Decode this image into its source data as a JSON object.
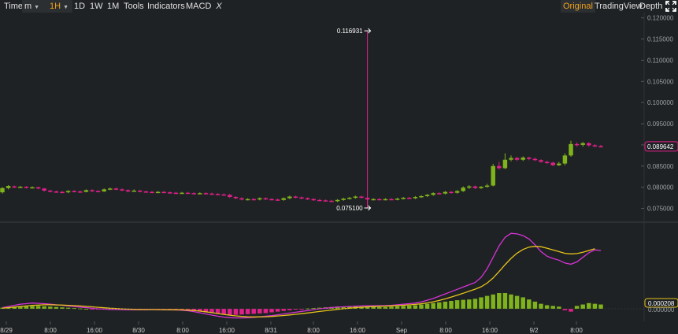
{
  "toolbar": {
    "time_label": "Time",
    "interval_select": "m",
    "active_interval": "1H",
    "intervals": [
      "1D",
      "1W",
      "1M"
    ],
    "tools_label": "Tools",
    "indicators_label": "Indicators",
    "indicator_name": "MACD",
    "indicator_remove": "X",
    "modes": [
      "Original",
      "TradingView",
      "Depth"
    ],
    "active_mode": "Original"
  },
  "colors": {
    "up": "#7fb31c",
    "down": "#e0208a",
    "macd_line": "#d633d6",
    "signal_line": "#e6c21a",
    "marker_line": "#e0208a",
    "background": "#1f2224"
  },
  "chart_data": {
    "type": "candlestick",
    "title": "",
    "price_axis": {
      "ticks": [
        "0.120000",
        "0.115000",
        "0.110000",
        "0.105000",
        "0.100000",
        "0.095000",
        "0.090000",
        "0.085000",
        "0.080000",
        "0.075000"
      ],
      "range": [
        0.0725,
        0.1205
      ]
    },
    "x_labels": [
      "8/29",
      "8:00",
      "16:00",
      "8/30",
      "8:00",
      "16:00",
      "8/31",
      "8:00",
      "16:00",
      "Sep",
      "8:00",
      "16:00",
      "9/2",
      "8:00"
    ],
    "current_price": "0.089642",
    "annotations": {
      "high": "0.116931",
      "low": "0.075100"
    },
    "candles": [
      [
        0.0788,
        0.0798,
        0.0785,
        0.08
      ],
      [
        0.0798,
        0.0803,
        0.0795,
        0.0805
      ],
      [
        0.0802,
        0.08,
        0.0798,
        0.0804
      ],
      [
        0.08,
        0.0801,
        0.0798,
        0.0803
      ],
      [
        0.0801,
        0.0799,
        0.0797,
        0.0803
      ],
      [
        0.0799,
        0.08,
        0.0797,
        0.0802
      ],
      [
        0.08,
        0.0797,
        0.0795,
        0.0801
      ],
      [
        0.0797,
        0.0792,
        0.079,
        0.0798
      ],
      [
        0.0792,
        0.079,
        0.0788,
        0.0794
      ],
      [
        0.079,
        0.0789,
        0.0787,
        0.0792
      ],
      [
        0.0789,
        0.0788,
        0.0786,
        0.0791
      ],
      [
        0.0788,
        0.0791,
        0.0786,
        0.0793
      ],
      [
        0.0791,
        0.079,
        0.0788,
        0.0793
      ],
      [
        0.079,
        0.0789,
        0.0787,
        0.0792
      ],
      [
        0.0789,
        0.0793,
        0.0788,
        0.0795
      ],
      [
        0.0793,
        0.0791,
        0.0789,
        0.0795
      ],
      [
        0.0791,
        0.079,
        0.0788,
        0.0793
      ],
      [
        0.079,
        0.0795,
        0.0789,
        0.0797
      ],
      [
        0.0795,
        0.0797,
        0.0793,
        0.0799
      ],
      [
        0.0797,
        0.0795,
        0.0793,
        0.0799
      ],
      [
        0.0795,
        0.0793,
        0.0791,
        0.0797
      ],
      [
        0.0793,
        0.079,
        0.0788,
        0.0795
      ],
      [
        0.079,
        0.0792,
        0.0789,
        0.0795
      ],
      [
        0.0792,
        0.079,
        0.0788,
        0.0794
      ],
      [
        0.079,
        0.0789,
        0.0787,
        0.0792
      ],
      [
        0.0789,
        0.0788,
        0.0786,
        0.0791
      ],
      [
        0.0788,
        0.0789,
        0.0786,
        0.0791
      ],
      [
        0.0789,
        0.0788,
        0.0786,
        0.0791
      ],
      [
        0.0788,
        0.0787,
        0.0785,
        0.079
      ],
      [
        0.0787,
        0.0786,
        0.0784,
        0.0789
      ],
      [
        0.0786,
        0.0787,
        0.0784,
        0.0789
      ],
      [
        0.0787,
        0.0786,
        0.0784,
        0.0789
      ],
      [
        0.0786,
        0.0785,
        0.0783,
        0.0788
      ],
      [
        0.0785,
        0.0786,
        0.0783,
        0.0788
      ],
      [
        0.0786,
        0.0785,
        0.0783,
        0.0788
      ],
      [
        0.0785,
        0.0784,
        0.0782,
        0.0787
      ],
      [
        0.0784,
        0.0783,
        0.0781,
        0.0786
      ],
      [
        0.0783,
        0.0782,
        0.078,
        0.0785
      ],
      [
        0.0782,
        0.0777,
        0.0775,
        0.0784
      ],
      [
        0.0777,
        0.0774,
        0.0772,
        0.0779
      ],
      [
        0.0774,
        0.0771,
        0.0769,
        0.0776
      ],
      [
        0.0771,
        0.0772,
        0.0769,
        0.0774
      ],
      [
        0.0772,
        0.0771,
        0.0769,
        0.0774
      ],
      [
        0.0771,
        0.0774,
        0.0769,
        0.0776
      ],
      [
        0.0774,
        0.0772,
        0.077,
        0.0776
      ],
      [
        0.0772,
        0.0771,
        0.0769,
        0.0774
      ],
      [
        0.0771,
        0.077,
        0.0768,
        0.0773
      ],
      [
        0.077,
        0.0774,
        0.0768,
        0.0776
      ],
      [
        0.0774,
        0.0778,
        0.0772,
        0.078
      ],
      [
        0.0778,
        0.0776,
        0.0774,
        0.078
      ],
      [
        0.0776,
        0.0774,
        0.0772,
        0.0778
      ],
      [
        0.0774,
        0.0772,
        0.077,
        0.0776
      ],
      [
        0.0772,
        0.077,
        0.0768,
        0.0774
      ],
      [
        0.077,
        0.0769,
        0.0767,
        0.0772
      ],
      [
        0.0769,
        0.0768,
        0.0766,
        0.0771
      ],
      [
        0.0768,
        0.0767,
        0.0765,
        0.077
      ],
      [
        0.0767,
        0.077,
        0.0765,
        0.0772
      ],
      [
        0.077,
        0.0773,
        0.0768,
        0.0775
      ],
      [
        0.0773,
        0.0775,
        0.0771,
        0.0777
      ],
      [
        0.0775,
        0.0778,
        0.0773,
        0.078
      ],
      [
        0.0778,
        0.0775,
        0.0774,
        0.078
      ],
      [
        0.0775,
        0.0771,
        0.0751,
        0.0776
      ],
      [
        0.0771,
        0.0772,
        0.0769,
        0.0774
      ],
      [
        0.0772,
        0.0771,
        0.0769,
        0.0774
      ],
      [
        0.0771,
        0.0772,
        0.0769,
        0.0774
      ],
      [
        0.0772,
        0.0771,
        0.0769,
        0.0774
      ],
      [
        0.0771,
        0.0773,
        0.0769,
        0.0775
      ],
      [
        0.0773,
        0.0775,
        0.0771,
        0.0777
      ],
      [
        0.0775,
        0.0774,
        0.0772,
        0.0777
      ],
      [
        0.0774,
        0.0777,
        0.0772,
        0.0779
      ],
      [
        0.0777,
        0.0779,
        0.0775,
        0.0781
      ],
      [
        0.0779,
        0.0782,
        0.0777,
        0.0784
      ],
      [
        0.0782,
        0.0786,
        0.078,
        0.0788
      ],
      [
        0.0786,
        0.0785,
        0.0783,
        0.0788
      ],
      [
        0.0785,
        0.0789,
        0.0783,
        0.0791
      ],
      [
        0.0789,
        0.0787,
        0.0785,
        0.0791
      ],
      [
        0.0787,
        0.0791,
        0.0785,
        0.0793
      ],
      [
        0.0791,
        0.0799,
        0.0789,
        0.0802
      ],
      [
        0.0799,
        0.0802,
        0.0796,
        0.0805
      ],
      [
        0.0802,
        0.0798,
        0.0796,
        0.0804
      ],
      [
        0.0798,
        0.0801,
        0.0796,
        0.0803
      ],
      [
        0.0801,
        0.0804,
        0.0799,
        0.0808
      ],
      [
        0.0804,
        0.085,
        0.0802,
        0.0855
      ],
      [
        0.085,
        0.0845,
        0.0842,
        0.086
      ],
      [
        0.0845,
        0.0865,
        0.0843,
        0.088
      ],
      [
        0.0865,
        0.0869,
        0.0861,
        0.0875
      ],
      [
        0.0869,
        0.0865,
        0.0862,
        0.0872
      ],
      [
        0.0865,
        0.087,
        0.0862,
        0.0873
      ],
      [
        0.087,
        0.0867,
        0.0864,
        0.0872
      ],
      [
        0.0867,
        0.0864,
        0.0862,
        0.087
      ],
      [
        0.0864,
        0.086,
        0.0858,
        0.0866
      ],
      [
        0.086,
        0.0858,
        0.0855,
        0.0862
      ],
      [
        0.0858,
        0.0852,
        0.085,
        0.086
      ],
      [
        0.0852,
        0.0856,
        0.085,
        0.086
      ],
      [
        0.0856,
        0.0875,
        0.0852,
        0.088
      ],
      [
        0.0875,
        0.0902,
        0.0872,
        0.091
      ],
      [
        0.0902,
        0.09,
        0.0896,
        0.0906
      ],
      [
        0.09,
        0.0904,
        0.0896,
        0.0907
      ],
      [
        0.0904,
        0.0899,
        0.0896,
        0.0906
      ],
      [
        0.0899,
        0.0897,
        0.0895,
        0.0902
      ],
      [
        0.0897,
        0.0896,
        0.0894,
        0.09
      ]
    ],
    "macd": {
      "histogram": [
        1.5,
        2,
        2.5,
        3,
        3.5,
        4,
        4,
        3.5,
        3,
        2.5,
        2,
        1.5,
        1,
        0.5,
        0,
        -0.5,
        -1,
        -1.2,
        -1.5,
        -1.5,
        -1.2,
        -1,
        -1,
        -0.8,
        -0.5,
        -0.5,
        -0.3,
        -0.5,
        -0.8,
        -1,
        -1.5,
        -2,
        -3,
        -4,
        -5,
        -6,
        -7,
        -8,
        -8.5,
        -8.5,
        -8,
        -7.5,
        -7,
        -6.5,
        -6,
        -5,
        -4,
        -3,
        -2,
        -1,
        -0.5,
        0.5,
        1,
        1.5,
        2,
        2.5,
        3,
        3,
        3.5,
        3.5,
        3,
        3,
        3,
        2.5,
        2.5,
        3,
        3.5,
        4,
        4.5,
        5,
        6,
        7,
        8,
        9,
        10,
        11,
        12,
        12.5,
        13,
        14,
        16,
        18,
        20,
        22,
        22,
        20,
        18,
        16,
        13,
        10,
        7,
        5,
        4,
        3,
        -2,
        -4,
        4,
        6,
        8,
        7,
        6
      ],
      "macd_line": [
        2,
        4,
        6,
        8,
        9,
        10,
        9.5,
        9,
        8,
        7,
        6,
        5,
        4,
        3,
        2,
        1,
        0,
        -0.5,
        -1,
        -1.3,
        -1.5,
        -1.6,
        -1.7,
        -1.7,
        -1.6,
        -1.5,
        -1.5,
        -1.6,
        -1.8,
        -2,
        -2.5,
        -3.5,
        -5,
        -7,
        -9,
        -11,
        -13,
        -14.5,
        -15.5,
        -16,
        -16,
        -15.5,
        -15,
        -14,
        -13,
        -12,
        -10.5,
        -9,
        -7.5,
        -6,
        -4.5,
        -3,
        -1.5,
        0,
        1,
        2,
        3,
        3.5,
        4,
        4.5,
        5,
        5.2,
        5.4,
        5.5,
        5.6,
        6,
        7,
        8,
        9,
        10,
        12,
        15,
        18,
        22,
        26,
        30,
        34,
        38,
        42,
        46,
        55,
        70,
        90,
        110,
        125,
        132,
        131,
        128,
        122,
        112,
        100,
        92,
        88,
        85,
        80,
        78,
        82,
        90,
        98,
        103,
        102
      ],
      "signal_line": [
        1,
        2,
        3,
        4,
        5,
        6,
        6.5,
        7,
        7,
        6.8,
        6.5,
        6,
        5.5,
        5,
        4.2,
        3.4,
        2.6,
        1.8,
        1,
        0.4,
        -0.2,
        -0.6,
        -0.9,
        -1.1,
        -1.2,
        -1.3,
        -1.4,
        -1.5,
        -1.6,
        -1.7,
        -1.9,
        -2.3,
        -3,
        -4,
        -5.3,
        -6.7,
        -8.2,
        -9.8,
        -11.2,
        -12.4,
        -13.3,
        -13.9,
        -14.2,
        -14.2,
        -13.9,
        -13.3,
        -12.6,
        -11.7,
        -10.8,
        -9.7,
        -8.5,
        -7.3,
        -6,
        -4.7,
        -3.4,
        -2.2,
        -1,
        0,
        1,
        2,
        2.8,
        3.4,
        3.9,
        4.3,
        4.7,
        5.1,
        5.6,
        6.2,
        6.9,
        7.7,
        8.8,
        10.3,
        12.2,
        14.6,
        17.4,
        20.5,
        23.8,
        27.2,
        30.8,
        34.3,
        38.6,
        44.9,
        53.9,
        65.1,
        77.1,
        88.1,
        97.3,
        103.7,
        107.9,
        109.3,
        108.5,
        106,
        103,
        100,
        97,
        96,
        96.6,
        98.8,
        102,
        105
      ],
      "last_value": "0.000208",
      "zero_label": "0.000000"
    }
  }
}
